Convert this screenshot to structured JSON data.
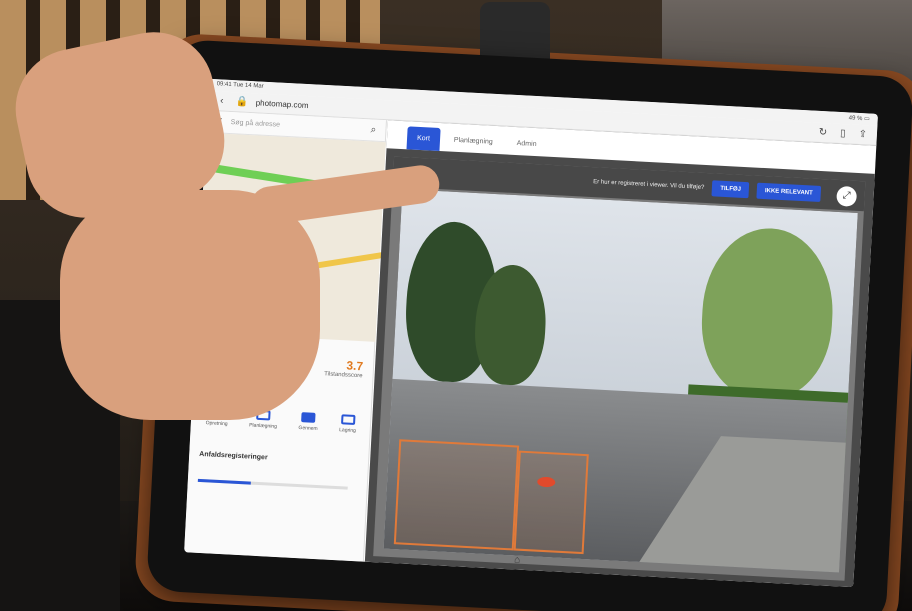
{
  "browser": {
    "url": "photomap.com",
    "status_left": "09:41 Tue 14 Mar",
    "status_right": "49 % ▭"
  },
  "left_panel": {
    "search_placeholder": "Søg på adresse",
    "score_value": "3.7",
    "score_label": "Tilstandsscore",
    "tools": [
      {
        "label": "Opretning",
        "icon": "crop-icon"
      },
      {
        "label": "Planlægning",
        "icon": "plan-icon"
      },
      {
        "label": "Gennem",
        "icon": "rect-icon"
      },
      {
        "label": "Lagring",
        "icon": "save-icon"
      }
    ],
    "annotations_title": "Anfaldsregisteringer",
    "progress_fraction": 0.35
  },
  "right_panel": {
    "tabs": [
      {
        "label": "Kort",
        "active": true
      },
      {
        "label": "Planlægning",
        "active": false
      },
      {
        "label": "Admin",
        "active": false
      }
    ],
    "prompt_text": "Er hur er registreret i viewer. Vil du tilføje?",
    "add_button": "TILFØJ",
    "not_relevant_button": "IKKE RELEVANT"
  },
  "colors": {
    "accent": "#2a56d6",
    "annotation": "#e07a3a"
  }
}
